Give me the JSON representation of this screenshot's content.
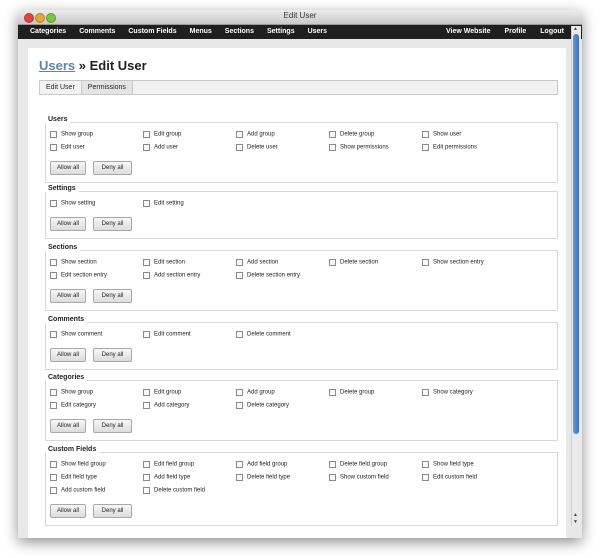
{
  "window": {
    "title": "Edit User"
  },
  "nav": {
    "left": [
      "Categories",
      "Comments",
      "Custom Fields",
      "Menus",
      "Sections",
      "Settings",
      "Users"
    ],
    "right": [
      "View Website",
      "Profile",
      "Logout"
    ]
  },
  "page": {
    "breadcrumb": "Users",
    "separator": "»",
    "title": "Edit User"
  },
  "tabs": [
    "Edit User",
    "Permissions"
  ],
  "panels": [
    {
      "title": "Users",
      "rows": [
        [
          "Show group",
          "Edit group",
          "Add group",
          "Delete group",
          "Show user"
        ],
        [
          "Edit user",
          "Add user",
          "Delete user",
          "Show permissions",
          "Edit permissions"
        ]
      ],
      "allow": "Allow all",
      "deny": "Deny all"
    },
    {
      "title": "Settings",
      "rows": [
        [
          "Show setting",
          "Edit setting"
        ]
      ],
      "allow": "Allow all",
      "deny": "Deny all"
    },
    {
      "title": "Sections",
      "rows": [
        [
          "Show section",
          "Edit section",
          "Add section",
          "Delete section",
          "Show section entry"
        ],
        [
          "Edit section entry",
          "Add section entry",
          "Delete section entry"
        ]
      ],
      "allow": "Allow all",
      "deny": "Deny all"
    },
    {
      "title": "Comments",
      "rows": [
        [
          "Show comment",
          "Edit comment",
          "Delete comment"
        ]
      ],
      "allow": "Allow all",
      "deny": "Deny all"
    },
    {
      "title": "Categories",
      "rows": [
        [
          "Show group",
          "Edit group",
          "Add group",
          "Delete group",
          "Show category"
        ],
        [
          "Edit category",
          "Add category",
          "Delete category"
        ]
      ],
      "allow": "Allow all",
      "deny": "Deny all"
    },
    {
      "title": "Custom Fields",
      "rows": [
        [
          "Show field group",
          "Edit field group",
          "Add field group",
          "Delete field group",
          "Show field type"
        ],
        [
          "Edit field type",
          "Add field type",
          "Delete field type",
          "Show custom field",
          "Edit custom field"
        ],
        [
          "Add custom field",
          "Delete custom field"
        ]
      ],
      "allow": "Allow all",
      "deny": "Deny all"
    }
  ]
}
